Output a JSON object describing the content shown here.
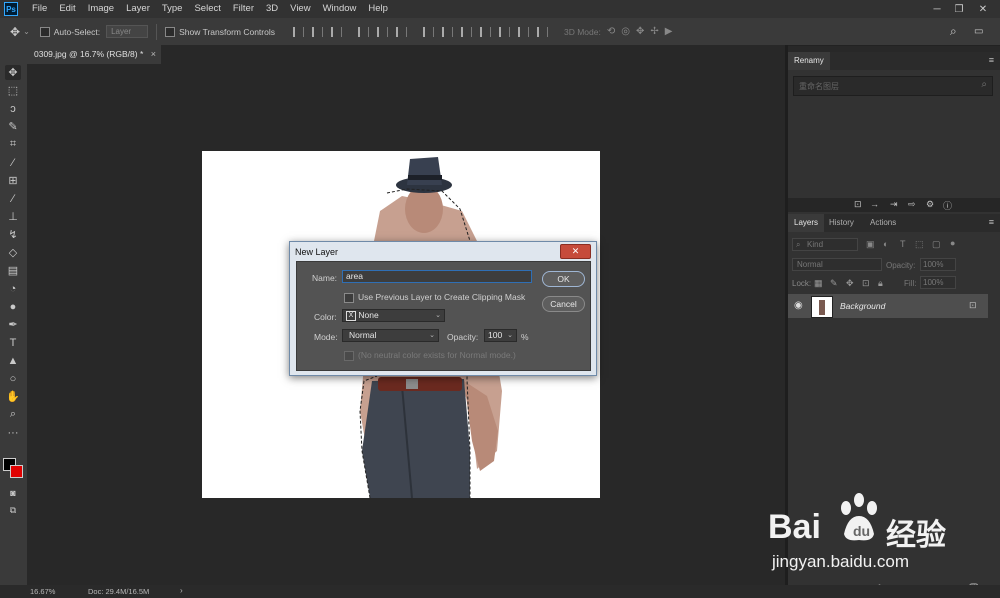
{
  "app": {
    "logo_text": "Ps",
    "menu": [
      "File",
      "Edit",
      "Image",
      "Layer",
      "Type",
      "Select",
      "Filter",
      "3D",
      "View",
      "Window",
      "Help"
    ],
    "window_controls": [
      "─",
      "❐",
      "✕"
    ]
  },
  "options_bar": {
    "auto_select_label": "Auto-Select:",
    "auto_select_value": "Layer",
    "show_transform_label": "Show Transform Controls",
    "mode_3d_label": "3D Mode:"
  },
  "document_tab": {
    "title": "0309.jpg @ 16.7% (RGB/8) *",
    "close": "×"
  },
  "new_layer_dialog": {
    "title": "New Layer",
    "close_symbol": "✕",
    "name_label": "Name:",
    "name_value": "area",
    "clipping_label": "Use Previous Layer to Create Clipping Mask",
    "color_label": "Color:",
    "color_value": "None",
    "color_swatch": "X",
    "mode_label": "Mode:",
    "mode_value": "Normal",
    "opacity_label": "Opacity:",
    "opacity_value": "100",
    "opacity_unit": "%",
    "neutral_label": "(No neutral color exists for Normal mode.)",
    "ok_label": "OK",
    "cancel_label": "Cancel"
  },
  "renamy_panel": {
    "title": "Renamy",
    "search_placeholder": "重命名图层"
  },
  "layers_panel": {
    "tabs": [
      "Layers",
      "History",
      "Actions"
    ],
    "kind_label": "Kind",
    "blend_mode": "Normal",
    "opacity_label": "Opacity:",
    "opacity_value": "100%",
    "lock_label": "Lock:",
    "fill_label": "Fill:",
    "fill_value": "100%",
    "layer_name": "Background"
  },
  "status_bar": {
    "zoom": "16.67%",
    "doc": "Doc: 29.4M/16.5M"
  },
  "watermark": {
    "brand": "Bai",
    "brand_cn": "经验",
    "url": "jingyan.baidu.com"
  },
  "colors": {
    "foreground": "#000000",
    "background": "#e00000",
    "accent": "#31a8ff"
  }
}
